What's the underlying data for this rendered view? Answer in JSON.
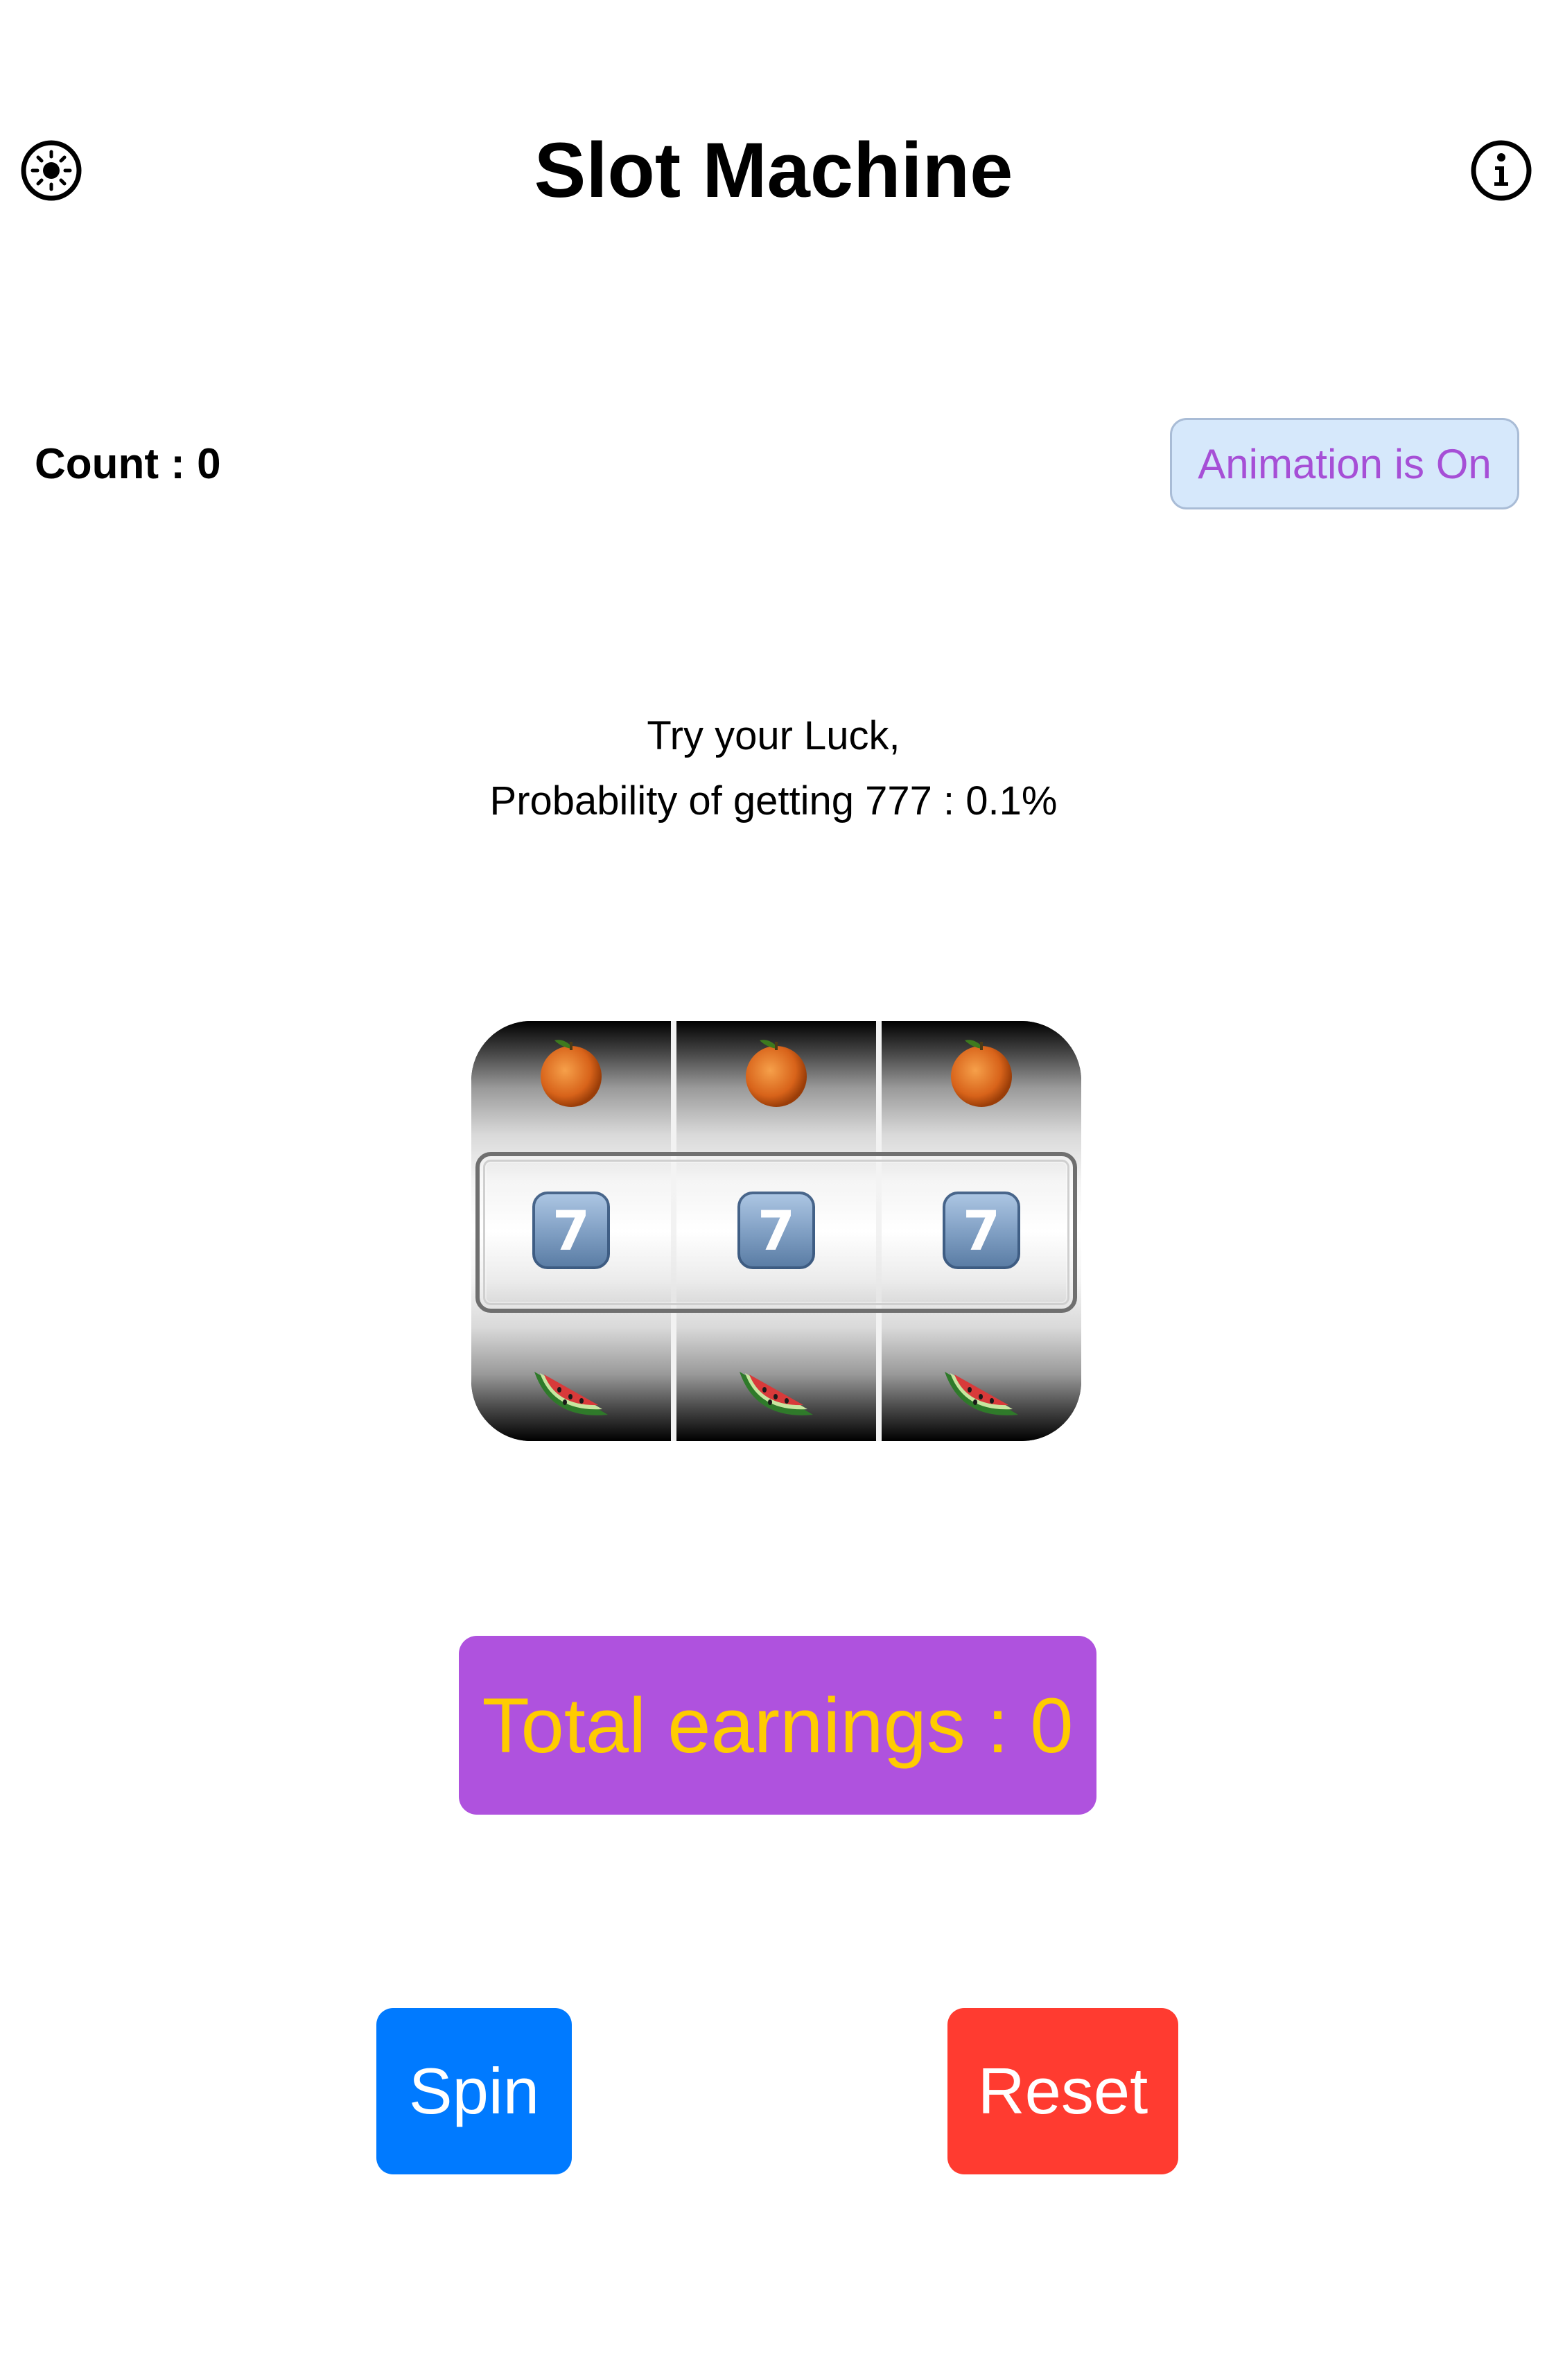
{
  "header": {
    "title": "Slot Machine",
    "left_icon": "brightness-icon",
    "right_icon": "info-icon"
  },
  "status": {
    "count_text": "Count : 0",
    "animation_toggle_label": "Animation is On"
  },
  "tagline": {
    "line1": "Try your Luck,",
    "line2": "Probability of getting 777 : 0.1%"
  },
  "reels": [
    {
      "top": "orange",
      "middle": "7",
      "bottom": "watermelon"
    },
    {
      "top": "orange",
      "middle": "7",
      "bottom": "watermelon"
    },
    {
      "top": "orange",
      "middle": "7",
      "bottom": "watermelon"
    }
  ],
  "earnings": {
    "text": "Total earnings : 0"
  },
  "buttons": {
    "spin_label": "Spin",
    "reset_label": "Reset"
  },
  "colors": {
    "toggle_bg": "#d6e8fb",
    "toggle_text": "#a64fd6",
    "earnings_bg": "#af52de",
    "earnings_text": "#ffcc00",
    "spin_bg": "#007aff",
    "reset_bg": "#ff3b30"
  }
}
